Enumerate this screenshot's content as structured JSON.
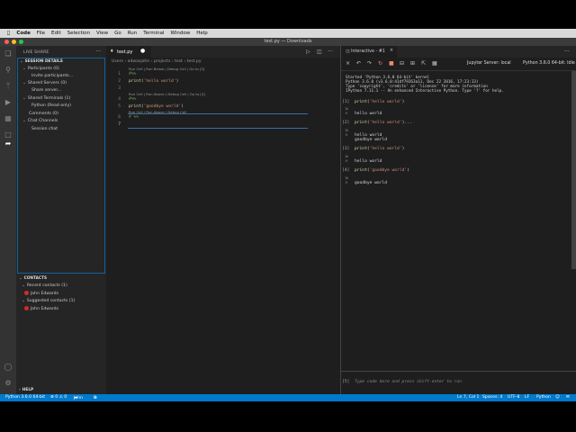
{
  "menubar": {
    "app": "Code",
    "items": [
      "File",
      "Edit",
      "Selection",
      "View",
      "Go",
      "Run",
      "Terminal",
      "Window",
      "Help"
    ]
  },
  "window_title": "test.py — Downloads",
  "sidebar": {
    "title": "LIVE SHARE",
    "session_header": "SESSION DETAILS",
    "participants": "Participants (0)",
    "invite": "Invite participants...",
    "shared_servers": "Shared Servers (0)",
    "share_server": "Share server...",
    "shared_terminals": "Shared Terminals (1)",
    "terminal_item": "Python (Read-only)",
    "comments": "Comments (0)",
    "chat_channels": "Chat Channels",
    "session_chat": "Session chat",
    "contacts_header": "CONTACTS",
    "recent_contacts": "Recent contacts (1)",
    "recent_name": "John Edwards",
    "suggested_contacts": "Suggested contacts (1)",
    "suggested_name": "John Edwards",
    "help_header": "HELP"
  },
  "editor": {
    "tab_label": "test.py",
    "breadcrumb": [
      "Users",
      "adwasjohn",
      "projects",
      "test",
      "test.py"
    ],
    "codelens_1": "Run Cell | Run Below | Debug Cell | Go to [3]",
    "codelens_2": "Run Cell | Run Above | Debug Cell | Go to [4]",
    "codelens_3": "Run Cell | Run Above | Debug Cell",
    "line_numbers": [
      "1",
      "2",
      "3",
      "4",
      "5",
      "6",
      "7"
    ],
    "lines": [
      "#%%",
      "print('hello world')",
      "",
      "#%%",
      "print('goodbye world')",
      "# %%",
      ""
    ]
  },
  "interactive": {
    "tab_label": "Interactive - #1",
    "server_label": "Jupyter Server: local",
    "kernel_label": "Python 3.6.0 64-bit: Idle",
    "banner": [
      "Started 'Python 3.6.0 64-bit' kernel",
      "Python 3.6.0 (v3.6.0:41df79263a11, Dec 22 2016, 17:23:13)",
      "Type 'copyright', 'credits' or 'license' for more information",
      "IPython 7.11.1 -- An enhanced Interactive Python. Type '?' for help."
    ],
    "cells": [
      {
        "num": "[1]",
        "code": "print('hello world')",
        "output": "hello world"
      },
      {
        "num": "[2]",
        "code": "print('hello world')...",
        "output": "hello world",
        "output2": "goodbye world"
      },
      {
        "num": "[3]",
        "code": "print('hello world')",
        "output": "hello world"
      },
      {
        "num": "[4]",
        "code": "print('goodbye world')",
        "output": "goodbye world"
      }
    ],
    "input_num": "[5]",
    "input_placeholder": "Type code here and press shift-enter to run"
  },
  "statusbar": {
    "interpreter": "Python 3.6.0 64-bit",
    "problems": "⊗ 0 ⚠ 0",
    "liveshare": "John",
    "ports": "0",
    "position": "Ln 7, Col 1",
    "spaces": "Spaces: 4",
    "encoding": "UTF-8",
    "eol": "LF",
    "language": "Python"
  },
  "colors": {
    "accent": "#007acc",
    "contact_dot": "#d02b2b",
    "string": "#ce9178",
    "function": "#dcdcaa",
    "comment": "#6a9955"
  }
}
